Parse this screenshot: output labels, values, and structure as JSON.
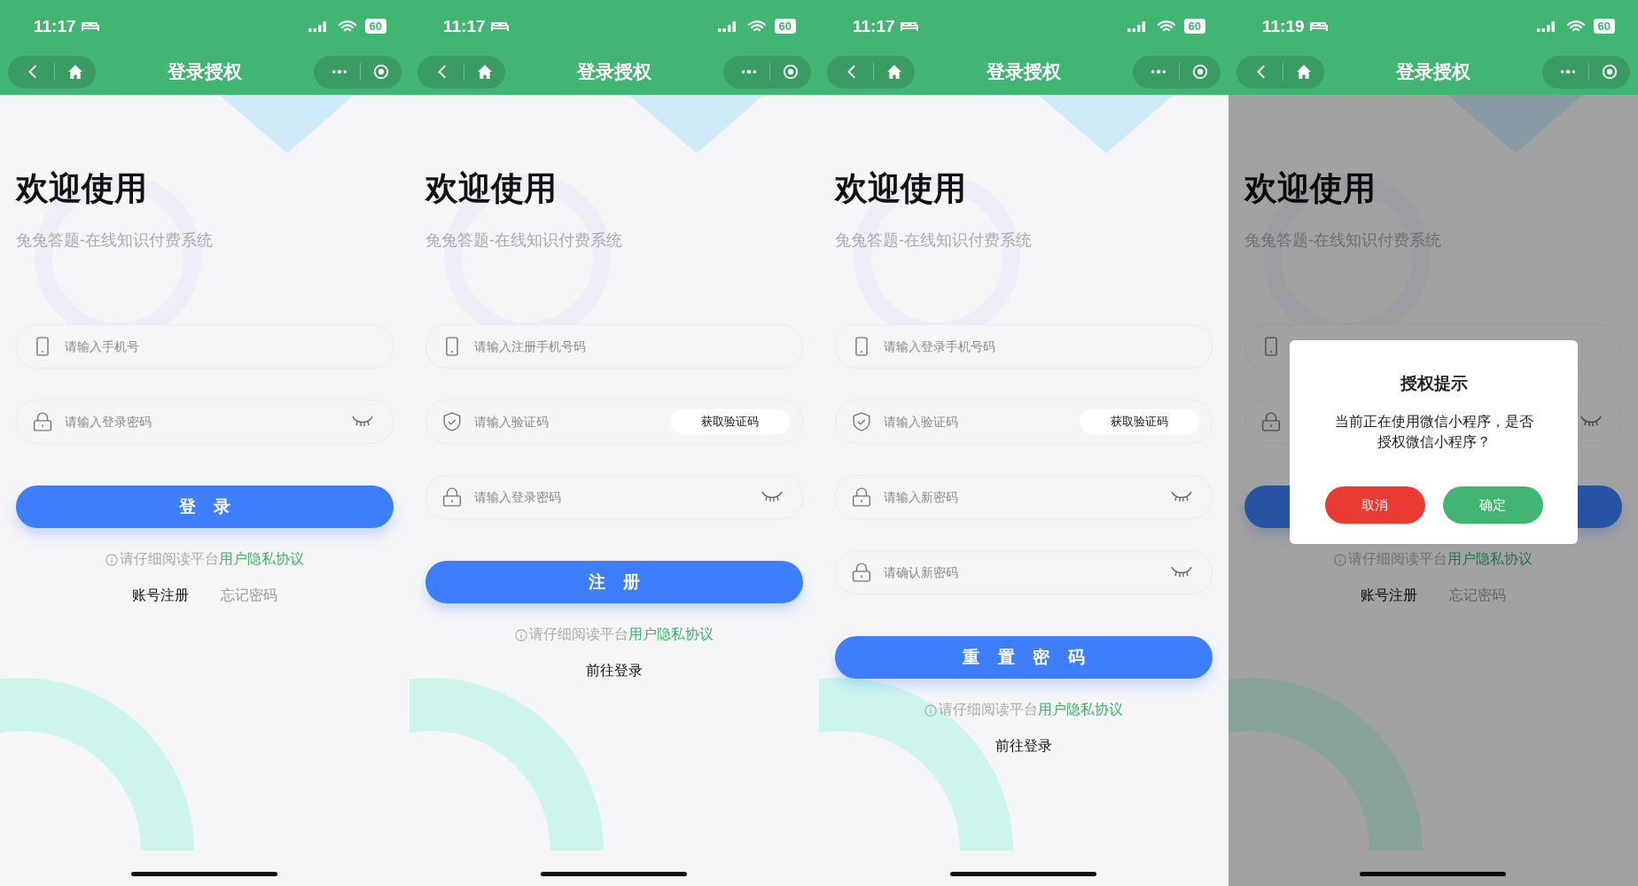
{
  "screens": [
    {
      "status_bar": {
        "time": "11:17",
        "battery": "60"
      },
      "nav": {
        "title": "登录授权"
      },
      "heading": "欢迎使用",
      "subtitle": "兔兔答题-在线知识付费系统",
      "fields": [
        {
          "kind": "phone",
          "placeholder": "请输入手机号"
        },
        {
          "kind": "password",
          "placeholder": "请输入登录密码"
        }
      ],
      "submit": {
        "label": "登录"
      },
      "agreement": {
        "text": "请仔细阅读平台",
        "link": "用户隐私协议"
      },
      "links": [
        {
          "label": "账号注册",
          "muted": false
        },
        {
          "label": "忘记密码",
          "muted": true
        }
      ]
    },
    {
      "status_bar": {
        "time": "11:17",
        "battery": "60"
      },
      "nav": {
        "title": "登录授权"
      },
      "heading": "欢迎使用",
      "subtitle": "兔兔答题-在线知识付费系统",
      "fields": [
        {
          "kind": "phone",
          "placeholder": "请输入注册手机号码"
        },
        {
          "kind": "code",
          "placeholder": "请输入验证码",
          "button": "获取验证码"
        },
        {
          "kind": "password",
          "placeholder": "请输入登录密码"
        }
      ],
      "submit": {
        "label": "注册"
      },
      "agreement": {
        "text": "请仔细阅读平台",
        "link": "用户隐私协议"
      },
      "links": [
        {
          "label": "前往登录",
          "muted": false
        }
      ]
    },
    {
      "status_bar": {
        "time": "11:17",
        "battery": "60"
      },
      "nav": {
        "title": "登录授权"
      },
      "heading": "欢迎使用",
      "subtitle": "兔兔答题-在线知识付费系统",
      "fields": [
        {
          "kind": "phone",
          "placeholder": "请输入登录手机号码"
        },
        {
          "kind": "code",
          "placeholder": "请输入验证码",
          "button": "获取验证码"
        },
        {
          "kind": "password",
          "placeholder": "请输入新密码"
        },
        {
          "kind": "password",
          "placeholder": "请确认新密码"
        }
      ],
      "submit": {
        "label": "重置密码"
      },
      "agreement": {
        "text": "请仔细阅读平台",
        "link": "用户隐私协议"
      },
      "links": [
        {
          "label": "前往登录",
          "muted": false
        }
      ]
    },
    {
      "status_bar": {
        "time": "11:19",
        "battery": "60"
      },
      "nav": {
        "title": "登录授权"
      },
      "heading": "欢迎使用",
      "subtitle": "兔兔答题-在线知识付费系统",
      "fields": [
        {
          "kind": "phone"
        },
        {
          "kind": "password"
        }
      ],
      "agreement": {
        "text": "请仔细阅读平台",
        "link": "用户隐私协议"
      },
      "links": [
        {
          "label": "账号注册",
          "muted": false
        },
        {
          "label": "忘记密码",
          "muted": true
        }
      ],
      "dialog": {
        "title": "授权提示",
        "message": "当前正在使用微信小程序，是否授权微信小程序？",
        "buttons": [
          {
            "kind": "cancel",
            "label": "取消"
          },
          {
            "kind": "confirm",
            "label": "确定"
          }
        ]
      }
    }
  ]
}
